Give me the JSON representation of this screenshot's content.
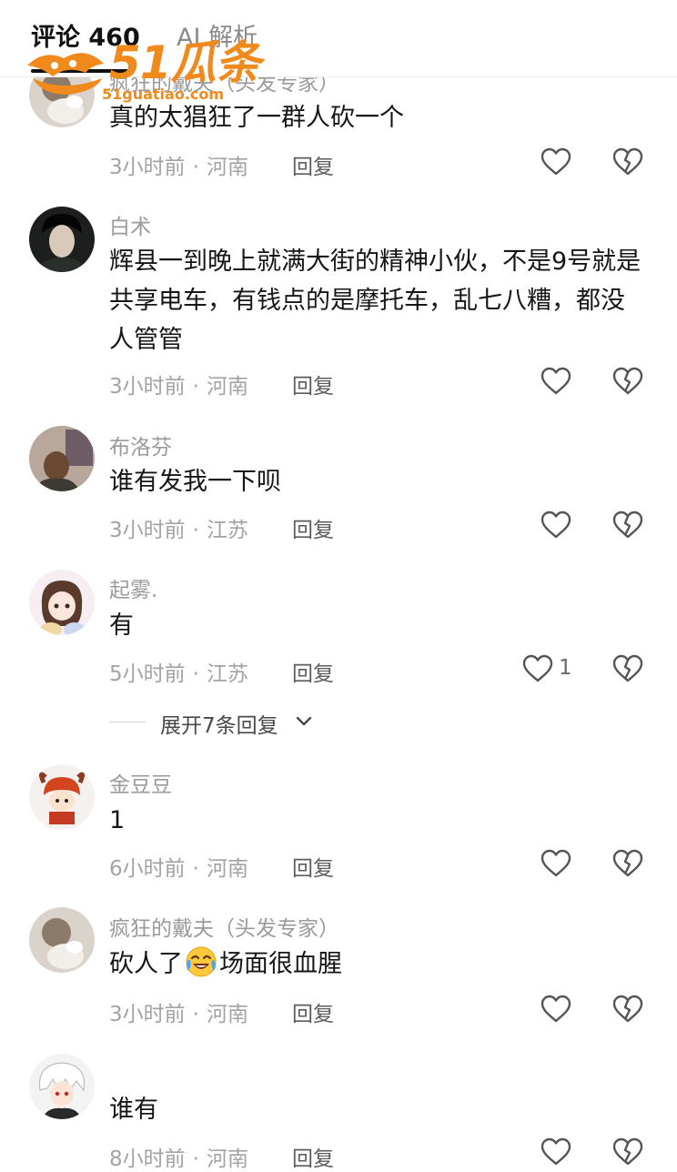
{
  "header": {
    "tabs": [
      {
        "label": "评论 460"
      },
      {
        "label": "AI 解析"
      }
    ]
  },
  "watermark": {
    "brand": "51瓜条",
    "url": "51guatiao.com"
  },
  "comments": [
    {
      "username": "疯狂的戴夫（头发专家）",
      "text": "真的太猖狂了一群人砍一个",
      "time": "3小时前",
      "location": "河南",
      "reply_label": "回复"
    },
    {
      "username": "白术",
      "text": "辉县一到晚上就满大街的精神小伙，不是9号就是共享电车，有钱点的是摩托车，乱七八糟，都没人管管",
      "time": "3小时前",
      "location": "河南",
      "reply_label": "回复"
    },
    {
      "username": "布洛芬",
      "text": "谁有发我一下呗",
      "time": "3小时前",
      "location": "江苏",
      "reply_label": "回复"
    },
    {
      "username": "起雾.",
      "text": "有",
      "time": "5小时前",
      "location": "江苏",
      "reply_label": "回复",
      "like_count": "1"
    },
    {
      "username": "金豆豆",
      "text": "1",
      "time": "6小时前",
      "location": "河南",
      "reply_label": "回复"
    },
    {
      "username": "疯狂的戴夫（头发专家）",
      "text_before_emoji": "砍人了",
      "emoji": "crying-laughing-emoji",
      "text_after_emoji": "场面很血腥",
      "time": "3小时前",
      "location": "河南",
      "reply_label": "回复"
    },
    {
      "username": "",
      "text": "谁有",
      "time": "8小时前",
      "location": "河南",
      "reply_label": "回复"
    }
  ],
  "expand_replies": {
    "label": "展开7条回复"
  },
  "icons": {
    "like": "heart-outline-icon",
    "dislike": "broken-heart-icon",
    "expand": "chevron-down-icon"
  },
  "colors": {
    "watermark": "#f08a1c",
    "meta_text": "#a3a3a3",
    "username": "#9a9a9a",
    "icon_stroke": "#555555"
  }
}
